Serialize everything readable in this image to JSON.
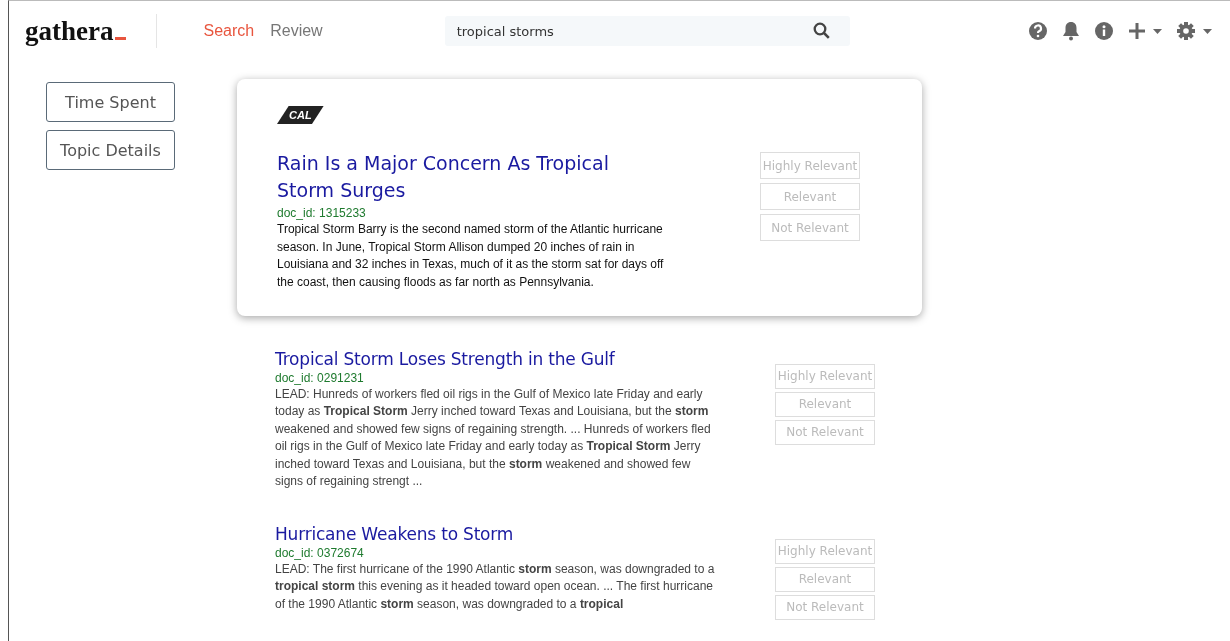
{
  "logo": {
    "text": "gathera"
  },
  "nav": [
    {
      "label": "Search",
      "selected": true
    },
    {
      "label": "Review",
      "selected": false
    }
  ],
  "search": {
    "value": "tropical storms"
  },
  "sidebar": {
    "buttons": [
      "Time Spent",
      "Topic Details"
    ]
  },
  "results": [
    {
      "kind": "featured",
      "tag": "CAL",
      "title": "Rain Is a Major Concern As Tropical Storm Surges",
      "doc_id": "doc_id: 1315233",
      "snippet": "Tropical Storm Barry is the second named storm of the Atlantic hurricane season. In June, Tropical Storm Allison dumped 20 inches of rain in Louisiana and 32 inches in Texas, much of it as the storm sat for days off the coast, then causing floods as far north as Pennsylvania.",
      "buttons": [
        "Highly Relevant",
        "Relevant",
        "Not Relevant"
      ]
    },
    {
      "kind": "plain",
      "title": "Tropical Storm Loses Strength in the Gulf",
      "doc_id": "doc_id: 0291231",
      "snippet": " LEAD: Hunreds of workers fled oil rigs in the Gulf of Mexico late Friday and early today as **Tropical Storm** Jerry inched toward Texas and Louisiana, but the **storm** weakened and showed few signs of regaining strength. ... Hunreds of workers fled oil rigs in the Gulf of Mexico late Friday and early today as **Tropical Storm** Jerry inched toward Texas and Louisiana, but the **storm** weakened and showed few signs of regaining strengt ...",
      "buttons": [
        "Highly Relevant",
        "Relevant",
        "Not Relevant"
      ]
    },
    {
      "kind": "plain",
      "title": "Hurricane Weakens to Storm",
      "doc_id": "doc_id: 0372674",
      "snippet": " LEAD: The first hurricane of the 1990 Atlantic **storm** season, was downgraded to a **tropical storm** this evening as it headed toward open ocean. ... The first hurricane of the 1990 Atlantic **storm** season, was downgraded to a **tropical**",
      "buttons": [
        "Highly Relevant",
        "Relevant",
        "Not Relevant"
      ]
    }
  ]
}
